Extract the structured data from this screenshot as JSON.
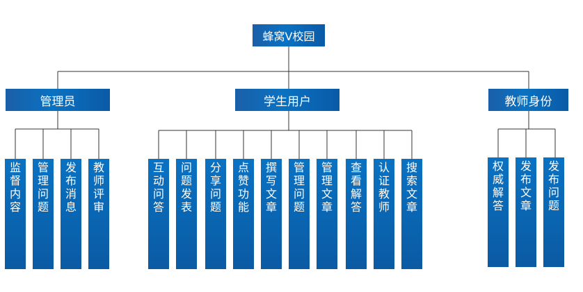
{
  "title": "蜂窝V校园",
  "roles": [
    {
      "label": "管理员",
      "features": [
        "监督内容",
        "管理问题",
        "发布消息",
        "教师评审"
      ]
    },
    {
      "label": "学生用户",
      "features": [
        "互动问答",
        "问题发表",
        "分享问题",
        "点赞功能",
        "撰写文章",
        "管理问题",
        "管理文章",
        "查看解答",
        "认证教师",
        "搜索文章"
      ]
    },
    {
      "label": "教师身份",
      "features": [
        "权威解答",
        "发布文章",
        "发布问题"
      ]
    }
  ],
  "colors": {
    "box": "#0a6cbf",
    "box_dark": "#0b5aa3",
    "line": "#333333",
    "text": "#ffffff"
  }
}
